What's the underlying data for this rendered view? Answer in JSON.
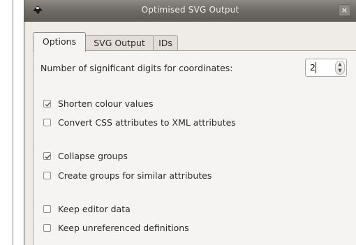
{
  "dialog": {
    "title": "Optimised SVG Output",
    "close_glyph": "×",
    "icon": "inkscape-icon"
  },
  "tabs": [
    {
      "label": "Options",
      "active": true
    },
    {
      "label": "SVG Output",
      "active": false
    },
    {
      "label": "IDs",
      "active": false
    }
  ],
  "options": {
    "digits_label": "Number of significant digits for coordinates:",
    "digits_value": "2",
    "spin_up_glyph": "▲",
    "spin_down_glyph": "▼",
    "checkboxes": [
      {
        "label": "Shorten colour values",
        "checked": true
      },
      {
        "label": "Convert CSS attributes to XML attributes",
        "checked": false
      },
      {
        "label": "Collapse groups",
        "checked": true
      },
      {
        "label": "Create groups for similar attributes",
        "checked": false
      },
      {
        "label": "Keep editor data",
        "checked": false
      },
      {
        "label": "Keep unreferenced definitions",
        "checked": false
      }
    ]
  }
}
